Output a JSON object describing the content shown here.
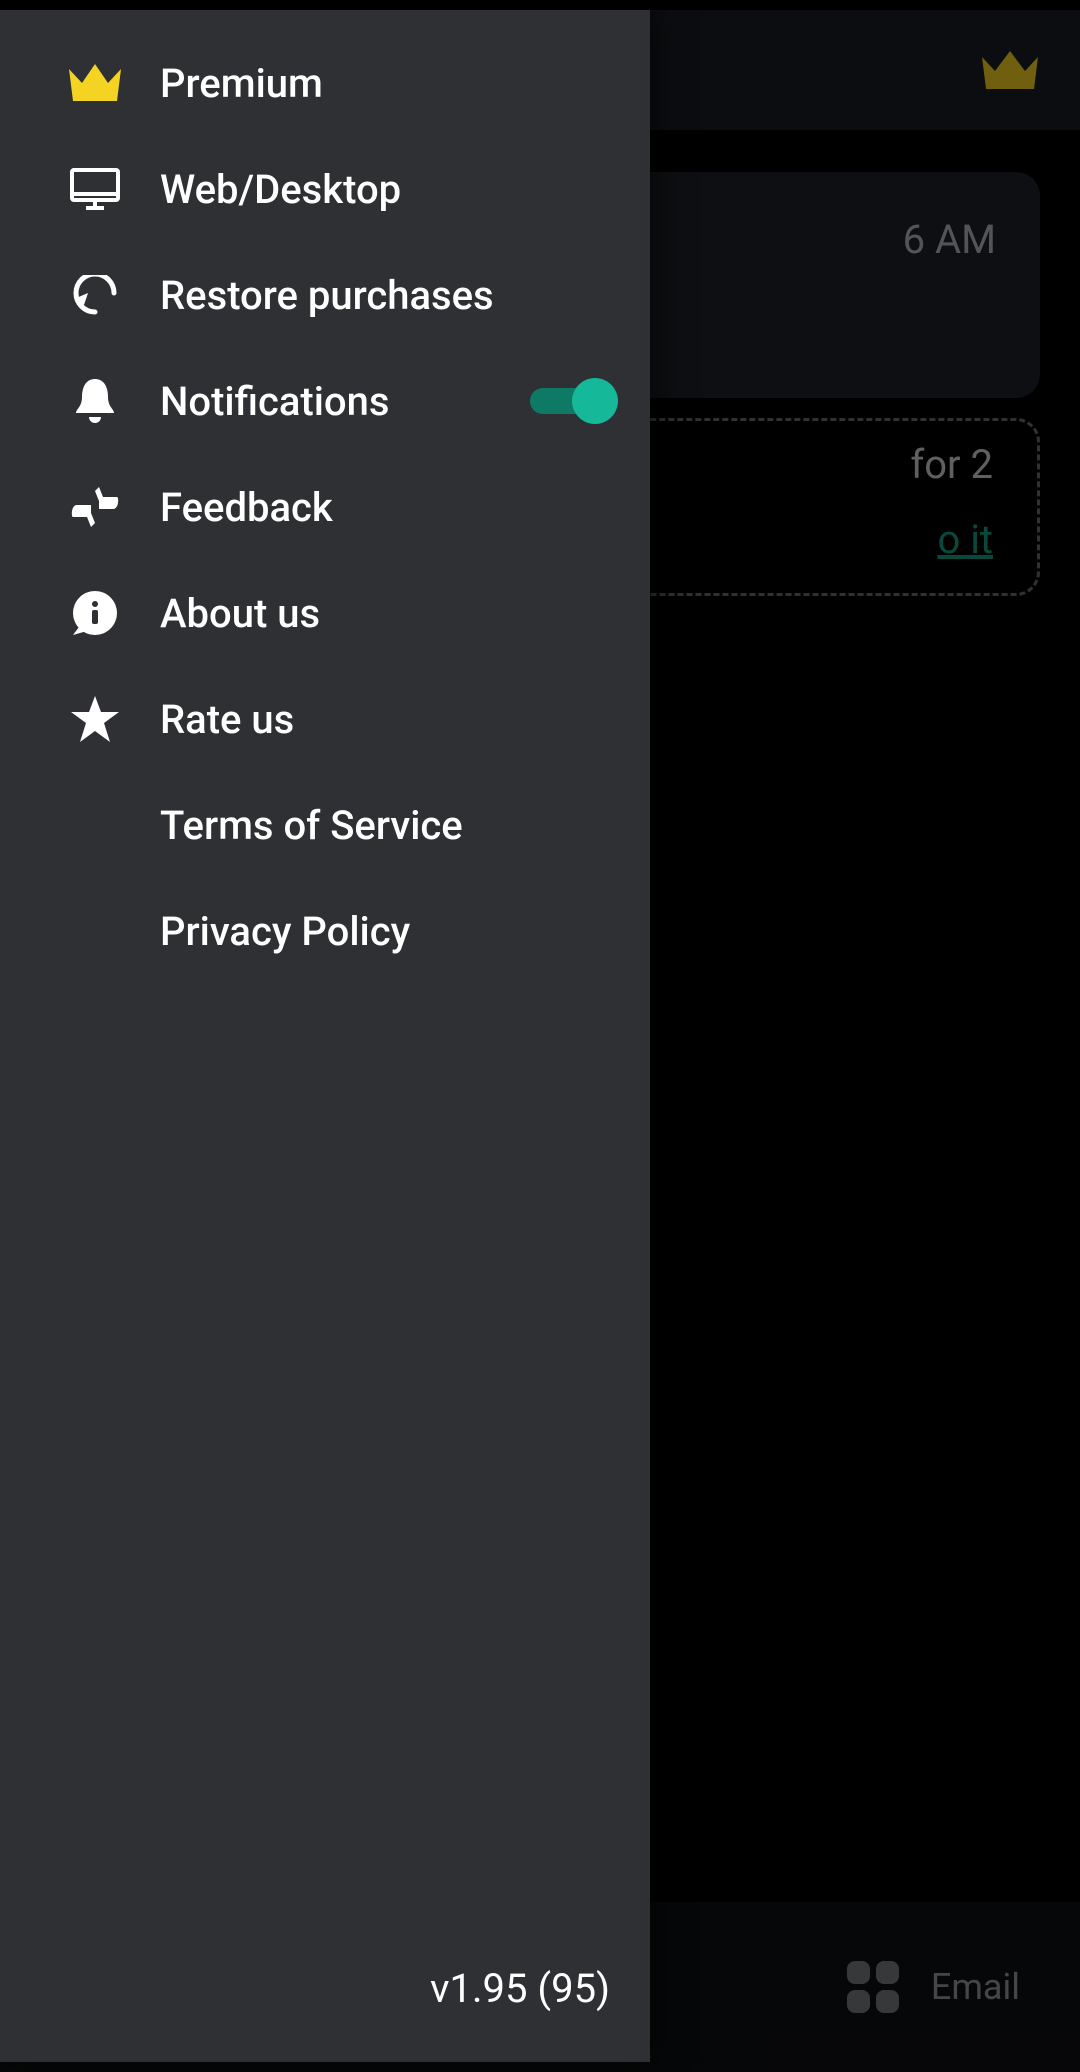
{
  "drawer": {
    "items": [
      {
        "label": "Premium"
      },
      {
        "label": "Web/Desktop"
      },
      {
        "label": "Restore purchases"
      },
      {
        "label": "Notifications",
        "toggle_on": true
      },
      {
        "label": "Feedback"
      },
      {
        "label": "About us"
      },
      {
        "label": "Rate us"
      },
      {
        "label": "Terms of Service"
      },
      {
        "label": "Privacy Policy"
      }
    ],
    "version": "v1.95 (95)"
  },
  "background": {
    "time_fragment": "6 AM",
    "streak_fragment": "for 2",
    "link_fragment": "o it",
    "bottom_label_fragment": "Email"
  },
  "colors": {
    "accent": "#16b89a",
    "crown": "#f5d323",
    "drawer_bg": "#2e3034"
  }
}
